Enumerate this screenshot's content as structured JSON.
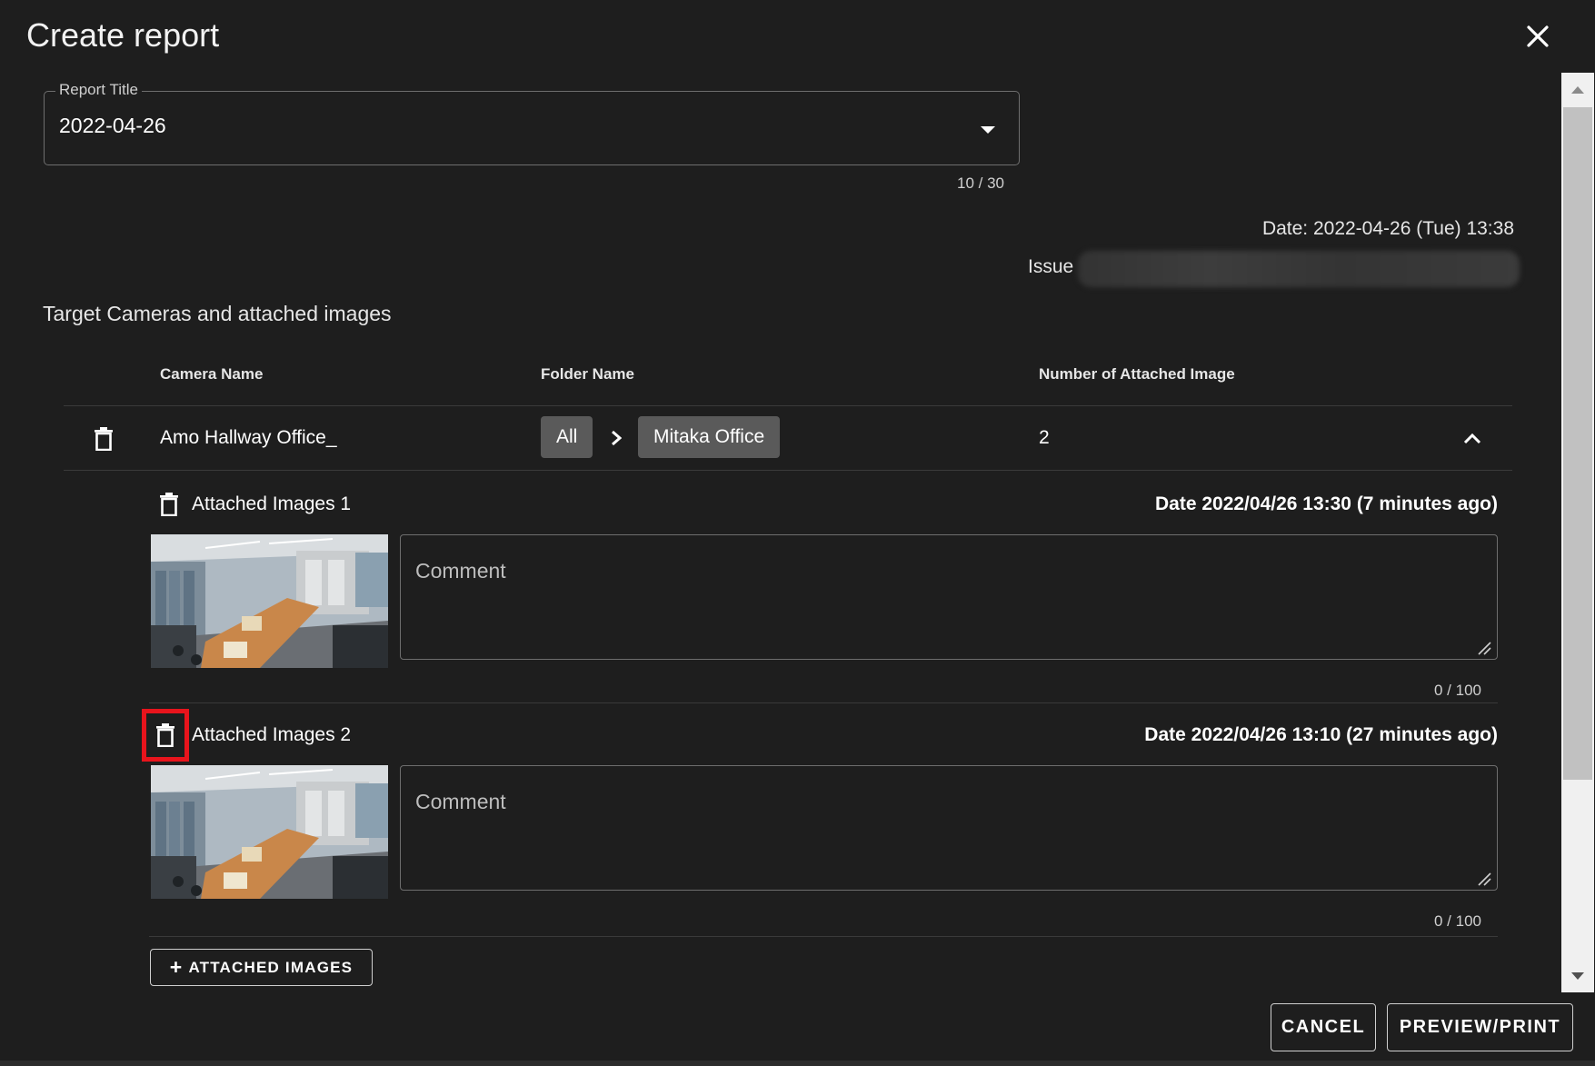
{
  "dialog": {
    "title": "Create report"
  },
  "report_title_field": {
    "label": "Report Title",
    "value": "2022-04-26",
    "counter": "10 / 30"
  },
  "meta": {
    "date": "Date: 2022-04-26 (Tue) 13:38",
    "issue_label": "Issue"
  },
  "section": {
    "title": "Target Cameras and attached images"
  },
  "table": {
    "headers": {
      "camera_name": "Camera Name",
      "folder_name": "Folder Name",
      "image_count": "Number of Attached Image"
    },
    "rows": [
      {
        "camera_name": "Amo Hallway Office_",
        "folder_path": [
          "All",
          "Mitaka Office"
        ],
        "image_count": "2",
        "expanded": true,
        "attachments": [
          {
            "title": "Attached Images 1",
            "date": "Date 2022/04/26 13:30 (7 minutes ago)",
            "comment_placeholder": "Comment",
            "comment_value": "",
            "counter": "0 / 100"
          },
          {
            "title": "Attached Images 2",
            "date": "Date 2022/04/26 13:10 (27 minutes ago)",
            "comment_placeholder": "Comment",
            "comment_value": "",
            "counter": "0 / 100"
          }
        ]
      }
    ]
  },
  "buttons": {
    "add_images": "ATTACHED IMAGES",
    "cancel": "CANCEL",
    "preview_print": "PREVIEW/PRINT"
  },
  "icons": {
    "close": "close-icon",
    "dropdown": "caret-down-icon",
    "delete": "trash-icon",
    "breadcrumb_separator": "chevron-right-icon",
    "collapse": "chevron-up-icon",
    "add": "plus-icon"
  },
  "colors": {
    "background": "#1e1e1e",
    "chip": "#5a5a5a",
    "highlight": "#e8141c",
    "border": "#6e6e6e"
  }
}
